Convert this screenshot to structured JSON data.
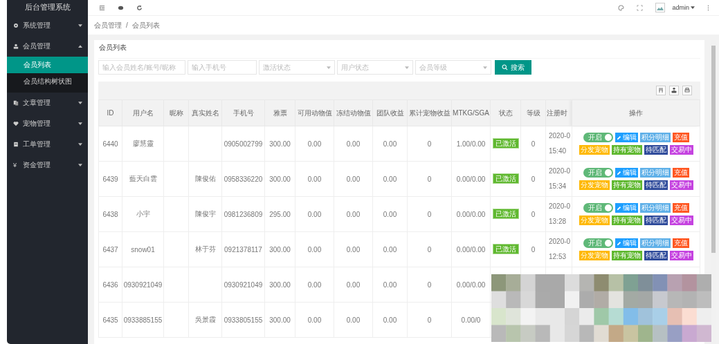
{
  "sidebar": {
    "title": "后台管理系统",
    "items": [
      {
        "label": "系统管理",
        "expanded": false
      },
      {
        "label": "会员管理",
        "expanded": true,
        "children": [
          {
            "label": "会员列表",
            "selected": true
          },
          {
            "label": "会员结构树状图",
            "selected": false
          }
        ]
      },
      {
        "label": "文章管理",
        "expanded": false
      },
      {
        "label": "宠物管理",
        "expanded": false
      },
      {
        "label": "工单管理",
        "expanded": false
      },
      {
        "label": "资金管理",
        "expanded": false,
        "glyph": "¥"
      }
    ]
  },
  "topbar": {
    "user": "admin"
  },
  "breadcrumb": [
    "会员管理",
    "/",
    "会员列表"
  ],
  "card_title": "会员列表",
  "filters": [
    {
      "kind": "input",
      "placeholder": "输入会员姓名/账号/昵称"
    },
    {
      "kind": "input",
      "placeholder": "输入手机号"
    },
    {
      "kind": "select",
      "placeholder": "激活状态"
    },
    {
      "kind": "select",
      "placeholder": "用户状态"
    },
    {
      "kind": "select",
      "placeholder": "会员等级"
    }
  ],
  "search_button": "搜索",
  "table": {
    "columns": [
      "ID",
      "用户名",
      "昵称",
      "真实姓名",
      "手机号",
      "雅票",
      "可用动物值",
      "冻结动物值",
      "团队收益",
      "累计宠物收益",
      "MTKG/SGA",
      "状态",
      "等级",
      "注册时",
      "操作"
    ],
    "rows": [
      {
        "cells": [
          "6440",
          "廖慧靈",
          "",
          "",
          "0905002799",
          "300.00",
          "0.00",
          "0.00",
          "0.00",
          "0",
          "1.00/0.00"
        ],
        "status": "已激活",
        "level": "0",
        "date": "2020-0",
        "time": "15:40",
        "toggle": {
          "label": "开启",
          "on": true
        },
        "actions": [
          "编辑",
          "积分明细",
          "充值",
          "分发宠物",
          "持有宠物",
          "待匹配",
          "交易中"
        ]
      },
      {
        "cells": [
          "6439",
          "藍天白雲",
          "",
          "陳俊佑",
          "0958336220",
          "300.00",
          "0.00",
          "0.00",
          "0.00",
          "0",
          "0.00/0.00"
        ],
        "status": "已激活",
        "level": "0",
        "date": "2020-0",
        "time": "15:34",
        "toggle": {
          "label": "开启",
          "on": true
        },
        "actions": [
          "编辑",
          "积分明细",
          "充值",
          "分发宠物",
          "持有宠物",
          "待匹配",
          "交易中"
        ]
      },
      {
        "cells": [
          "6438",
          "小宇",
          "",
          "陳俊宇",
          "0981236809",
          "295.00",
          "0.00",
          "0.00",
          "0.00",
          "0",
          "0.00/0.00"
        ],
        "status": "已激活",
        "level": "0",
        "date": "2020-0",
        "time": "13:28",
        "toggle": {
          "label": "开启",
          "on": true
        },
        "actions": [
          "编辑",
          "积分明细",
          "充值",
          "分发宠物",
          "持有宠物",
          "待匹配",
          "交易中"
        ]
      },
      {
        "cells": [
          "6437",
          "snow01",
          "",
          "林于芬",
          "0921378117",
          "300.00",
          "0.00",
          "0.00",
          "0.00",
          "0",
          "0.00/0.00"
        ],
        "status": "已激活",
        "level": "0",
        "date": "2020-0",
        "time": "12:53",
        "toggle": {
          "label": "开启",
          "on": true
        },
        "actions": [
          "编辑",
          "积分明细",
          "充值",
          "分发宠物",
          "持有宠物",
          "待匹配",
          "交易中"
        ]
      },
      {
        "cells": [
          "6436",
          "0930921049",
          "",
          "",
          "0930921049",
          "300.00",
          "0.00",
          "0.00",
          "0.00",
          "0",
          "0.00/0.00"
        ]
      },
      {
        "cells": [
          "6435",
          "0933885155",
          "",
          "吳景霞",
          "0933805155",
          "300.00",
          "0.00",
          "0.00",
          "0.00",
          "0",
          "0.00/0"
        ]
      }
    ]
  }
}
